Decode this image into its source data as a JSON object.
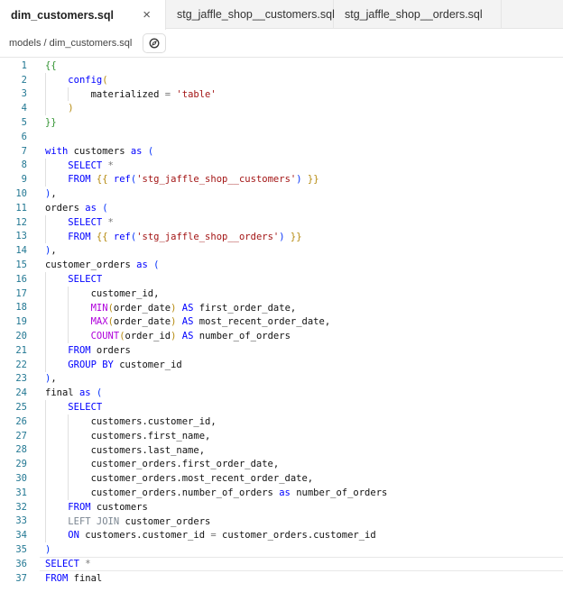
{
  "tabs": [
    {
      "label": "dim_customers.sql",
      "active": true
    },
    {
      "label": "stg_jaffle_shop__customers.sql"
    },
    {
      "label": "stg_jaffle_shop__orders.sql"
    }
  ],
  "close_icon": "×",
  "breadcrumb": "models / dim_customers.sql",
  "breadcrumb_icon": "compass-icon",
  "current_line": 36,
  "code": [
    [
      [
        "p3",
        "{{"
      ]
    ],
    [
      [
        "",
        "    "
      ],
      [
        "k",
        "config"
      ],
      [
        "p2",
        "("
      ]
    ],
    [
      [
        "",
        "        "
      ],
      [
        "t",
        "materialized "
      ],
      [
        "o",
        "="
      ],
      [
        "t",
        " "
      ],
      [
        "s",
        "'table'"
      ]
    ],
    [
      [
        "",
        "    "
      ],
      [
        "p2",
        ")"
      ]
    ],
    [
      [
        "p3",
        "}}"
      ]
    ],
    [],
    [
      [
        "k",
        "with"
      ],
      [
        "t",
        " customers "
      ],
      [
        "k",
        "as"
      ],
      [
        "t",
        " "
      ],
      [
        "p1",
        "("
      ]
    ],
    [
      [
        "",
        "    "
      ],
      [
        "k",
        "SELECT"
      ],
      [
        "o",
        " *"
      ]
    ],
    [
      [
        "",
        "    "
      ],
      [
        "k",
        "FROM"
      ],
      [
        "t",
        " "
      ],
      [
        "p2",
        "{{"
      ],
      [
        "t",
        " "
      ],
      [
        "k",
        "ref"
      ],
      [
        "p1",
        "("
      ],
      [
        "s",
        "'stg_jaffle_shop__customers'"
      ],
      [
        "p1",
        ")"
      ],
      [
        "t",
        " "
      ],
      [
        "p2",
        "}}"
      ]
    ],
    [
      [
        "p1",
        ")"
      ],
      [
        "t",
        ","
      ]
    ],
    [
      [
        "t",
        "orders "
      ],
      [
        "k",
        "as"
      ],
      [
        "t",
        " "
      ],
      [
        "p1",
        "("
      ]
    ],
    [
      [
        "",
        "    "
      ],
      [
        "k",
        "SELECT"
      ],
      [
        "o",
        " *"
      ]
    ],
    [
      [
        "",
        "    "
      ],
      [
        "k",
        "FROM"
      ],
      [
        "t",
        " "
      ],
      [
        "p2",
        "{{"
      ],
      [
        "t",
        " "
      ],
      [
        "k",
        "ref"
      ],
      [
        "p1",
        "("
      ],
      [
        "s",
        "'stg_jaffle_shop__orders'"
      ],
      [
        "p1",
        ")"
      ],
      [
        "t",
        " "
      ],
      [
        "p2",
        "}}"
      ]
    ],
    [
      [
        "p1",
        ")"
      ],
      [
        "t",
        ","
      ]
    ],
    [
      [
        "t",
        "customer_orders "
      ],
      [
        "k",
        "as"
      ],
      [
        "t",
        " "
      ],
      [
        "p1",
        "("
      ]
    ],
    [
      [
        "",
        "    "
      ],
      [
        "k",
        "SELECT"
      ]
    ],
    [
      [
        "",
        "        "
      ],
      [
        "t",
        "customer_id,"
      ]
    ],
    [
      [
        "",
        "        "
      ],
      [
        "f",
        "MIN"
      ],
      [
        "p2",
        "("
      ],
      [
        "t",
        "order_date"
      ],
      [
        "p2",
        ")"
      ],
      [
        "t",
        " "
      ],
      [
        "k",
        "AS"
      ],
      [
        "t",
        " first_order_date,"
      ]
    ],
    [
      [
        "",
        "        "
      ],
      [
        "f",
        "MAX"
      ],
      [
        "p2",
        "("
      ],
      [
        "t",
        "order_date"
      ],
      [
        "p2",
        ")"
      ],
      [
        "t",
        " "
      ],
      [
        "k",
        "AS"
      ],
      [
        "t",
        " most_recent_order_date,"
      ]
    ],
    [
      [
        "",
        "        "
      ],
      [
        "f",
        "COUNT"
      ],
      [
        "p2",
        "("
      ],
      [
        "t",
        "order_id"
      ],
      [
        "p2",
        ")"
      ],
      [
        "t",
        " "
      ],
      [
        "k",
        "AS"
      ],
      [
        "t",
        " number_of_orders"
      ]
    ],
    [
      [
        "",
        "    "
      ],
      [
        "k",
        "FROM"
      ],
      [
        "t",
        " orders"
      ]
    ],
    [
      [
        "",
        "    "
      ],
      [
        "k",
        "GROUP BY"
      ],
      [
        "t",
        " customer_id"
      ]
    ],
    [
      [
        "p1",
        ")"
      ],
      [
        "t",
        ","
      ]
    ],
    [
      [
        "t",
        "final "
      ],
      [
        "k",
        "as"
      ],
      [
        "t",
        " "
      ],
      [
        "p1",
        "("
      ]
    ],
    [
      [
        "",
        "    "
      ],
      [
        "k",
        "SELECT"
      ]
    ],
    [
      [
        "",
        "        "
      ],
      [
        "t",
        "customers.customer_id,"
      ]
    ],
    [
      [
        "",
        "        "
      ],
      [
        "t",
        "customers.first_name,"
      ]
    ],
    [
      [
        "",
        "        "
      ],
      [
        "t",
        "customers.last_name,"
      ]
    ],
    [
      [
        "",
        "        "
      ],
      [
        "t",
        "customer_orders.first_order_date,"
      ]
    ],
    [
      [
        "",
        "        "
      ],
      [
        "t",
        "customer_orders.most_recent_order_date,"
      ]
    ],
    [
      [
        "",
        "        "
      ],
      [
        "t",
        "customer_orders.number_of_orders "
      ],
      [
        "k",
        "as"
      ],
      [
        "t",
        " number_of_orders"
      ]
    ],
    [
      [
        "",
        "    "
      ],
      [
        "k",
        "FROM"
      ],
      [
        "t",
        " customers"
      ]
    ],
    [
      [
        "",
        "    "
      ],
      [
        "g",
        "LEFT JOIN"
      ],
      [
        "t",
        " customer_orders"
      ]
    ],
    [
      [
        "",
        "    "
      ],
      [
        "k",
        "ON"
      ],
      [
        "t",
        " customers.customer_id "
      ],
      [
        "o",
        "="
      ],
      [
        "t",
        " customer_orders.customer_id"
      ]
    ],
    [
      [
        "p1",
        ")"
      ]
    ],
    [
      [
        "k",
        "SELECT"
      ],
      [
        "o",
        " *"
      ]
    ],
    [
      [
        "k",
        "FROM"
      ],
      [
        "t",
        " final"
      ]
    ]
  ]
}
